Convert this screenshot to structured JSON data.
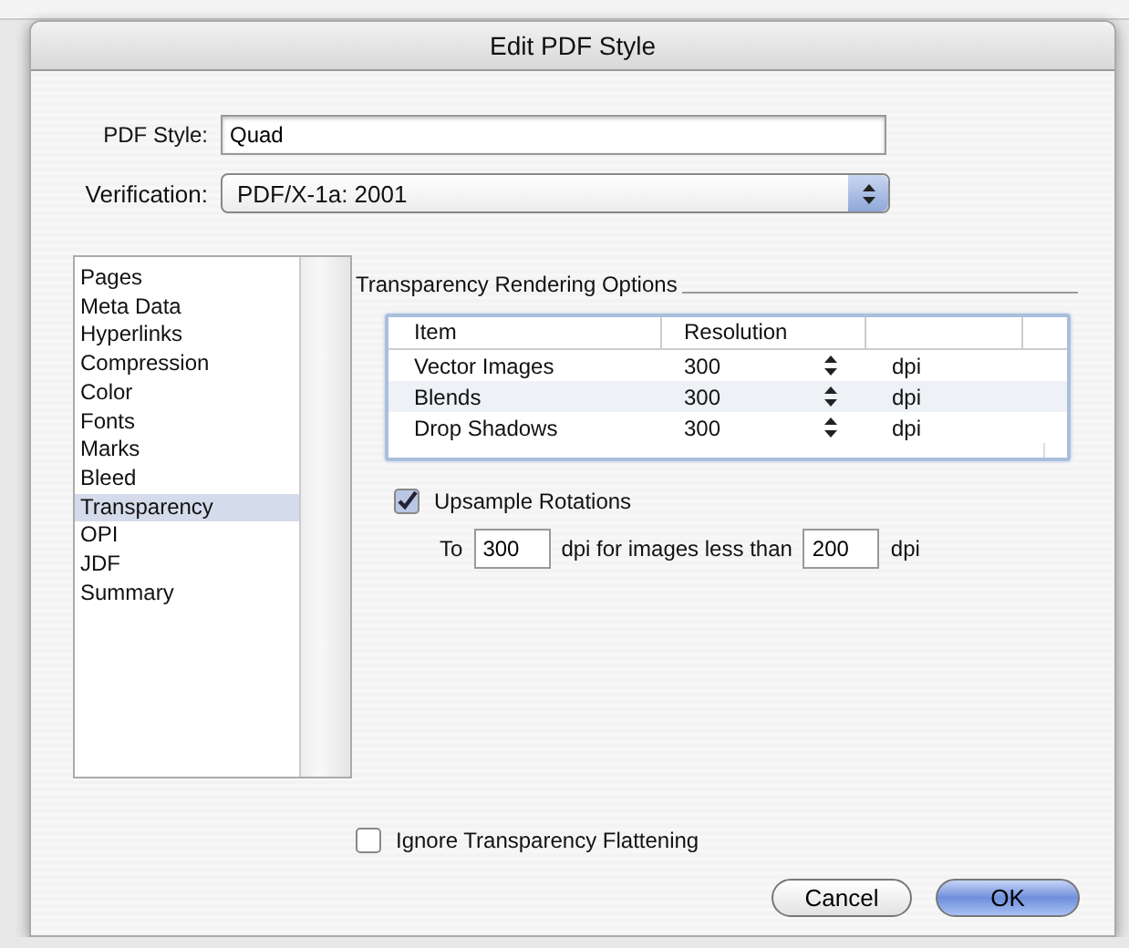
{
  "window": {
    "title": "Edit PDF Style"
  },
  "pdf_style": {
    "label": "PDF Style:",
    "value": "Quad"
  },
  "verification": {
    "label": "Verification:",
    "value": "PDF/X-1a: 2001"
  },
  "sidebar": {
    "items": [
      {
        "label": "Pages",
        "selected": false
      },
      {
        "label": "Meta Data",
        "selected": false
      },
      {
        "label": "Hyperlinks",
        "selected": false
      },
      {
        "label": "Compression",
        "selected": false
      },
      {
        "label": "Color",
        "selected": false
      },
      {
        "label": "Fonts",
        "selected": false
      },
      {
        "label": "Marks",
        "selected": false
      },
      {
        "label": "Bleed",
        "selected": false
      },
      {
        "label": "Transparency",
        "selected": true
      },
      {
        "label": "OPI",
        "selected": false
      },
      {
        "label": "JDF",
        "selected": false
      },
      {
        "label": "Summary",
        "selected": false
      }
    ]
  },
  "section": {
    "title": "Transparency Rendering Options",
    "table": {
      "columns": [
        "Item",
        "Resolution"
      ],
      "rows": [
        {
          "item": "Vector Images",
          "resolution": "300",
          "unit": "dpi"
        },
        {
          "item": "Blends",
          "resolution": "300",
          "unit": "dpi"
        },
        {
          "item": "Drop Shadows",
          "resolution": "300",
          "unit": "dpi"
        }
      ]
    },
    "upsample": {
      "label": "Upsample Rotations",
      "checked": true
    },
    "dpi_row": {
      "prefix": "To",
      "value1": "300",
      "middle": "dpi for images less than",
      "value2": "200",
      "suffix": "dpi"
    },
    "ignore": {
      "label": "Ignore Transparency Flattening",
      "checked": false
    }
  },
  "buttons": [
    {
      "label": "Cancel",
      "default": false
    },
    {
      "label": "OK",
      "default": true
    }
  ]
}
